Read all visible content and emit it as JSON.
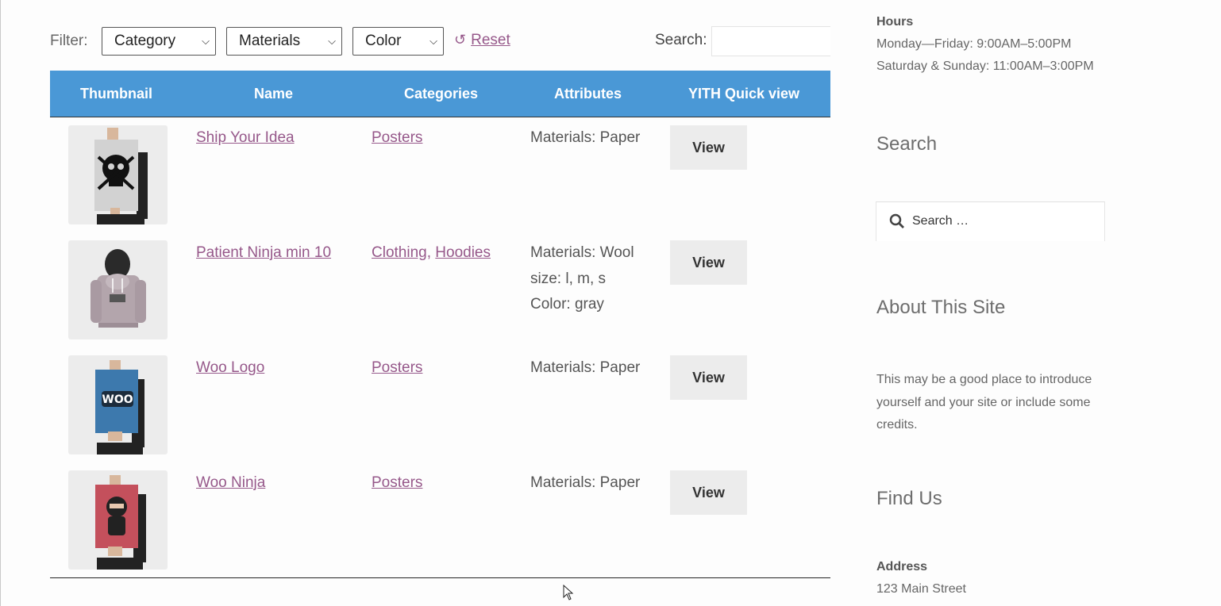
{
  "filter": {
    "label": "Filter:",
    "selects": [
      "Category",
      "Materials",
      "Color"
    ],
    "reset_label": "Reset",
    "search_label": "Search:",
    "search_value": ""
  },
  "table": {
    "header_color": "#4a98d6",
    "link_color": "#96588a",
    "columns": [
      "Thumbnail",
      "Name",
      "Categories",
      "Attributes",
      "YITH Quick view"
    ],
    "rows": [
      {
        "name": "Ship Your Idea",
        "categories": [
          "Posters"
        ],
        "attributes": [
          "Materials: Paper"
        ],
        "action": "View",
        "thumb": "skull-poster-icon"
      },
      {
        "name": "Patient Ninja min 10",
        "categories": [
          "Clothing",
          "Hoodies"
        ],
        "attributes": [
          "Materials: Wool",
          "size: l, m, s",
          "Color: gray"
        ],
        "action": "View",
        "thumb": "hoodie-icon"
      },
      {
        "name": "Woo Logo",
        "categories": [
          "Posters"
        ],
        "attributes": [
          "Materials: Paper"
        ],
        "action": "View",
        "thumb": "woo-poster-icon"
      },
      {
        "name": "Woo Ninja",
        "categories": [
          "Posters"
        ],
        "attributes": [
          "Materials: Paper"
        ],
        "action": "View",
        "thumb": "ninja-poster-icon"
      }
    ],
    "category_separator": ","
  },
  "sidebar": {
    "hours_title": "Hours",
    "hours_weekday": "Monday—Friday: 9:00AM–5:00PM",
    "hours_weekend": "Saturday & Sunday: 11:00AM–3:00PM",
    "search_title": "Search",
    "search_placeholder": "Search …",
    "about_title": "About This Site",
    "about_lines": [
      "This may be a good place to introduce",
      "yourself and your site or include some",
      "credits."
    ],
    "find_title": "Find Us",
    "address_title": "Address",
    "address_line": "123 Main Street"
  }
}
